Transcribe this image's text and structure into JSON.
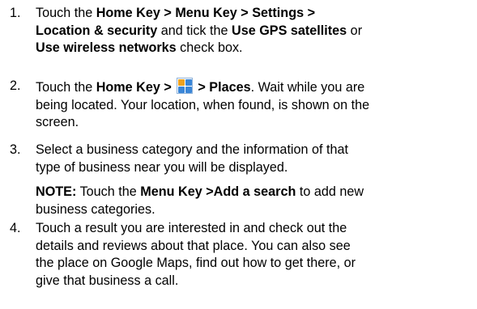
{
  "steps": [
    {
      "number": "1.",
      "lines": [
        [
          "Touch the ",
          "Home Key > Menu Key > Settings >"
        ],
        [
          "Location & security",
          " and tick the ",
          "Use GPS satellites",
          " or"
        ],
        [
          "Use wireless networks",
          " check box."
        ]
      ]
    },
    {
      "number": "2.",
      "lines": [
        [
          "Touch the ",
          "Home Key >",
          "> Places",
          ". Wait while you are"
        ],
        [
          "being located. Your location, when found, is shown on the"
        ],
        [
          "screen."
        ]
      ],
      "icon": "apps-grid-icon"
    },
    {
      "number": "3.",
      "lines": [
        [
          "Select a business category and the information of that"
        ],
        [
          "type of business near you will be displayed."
        ]
      ],
      "note": [
        [
          "NOTE:",
          " Touch the ",
          "Menu Key >Add a search",
          " to add new"
        ],
        [
          "business categories."
        ]
      ]
    },
    {
      "number": "4.",
      "lines": [
        [
          "Touch a result you are interested in and check out the"
        ],
        [
          "details and reviews about that place. You can also see"
        ],
        [
          "the place on Google Maps, find out how to get there, or"
        ],
        [
          "give that business a call."
        ]
      ]
    }
  ],
  "colors": {
    "text": "#000000",
    "icon_orange": "#f0a21f",
    "icon_blue": "#3a86d8"
  }
}
